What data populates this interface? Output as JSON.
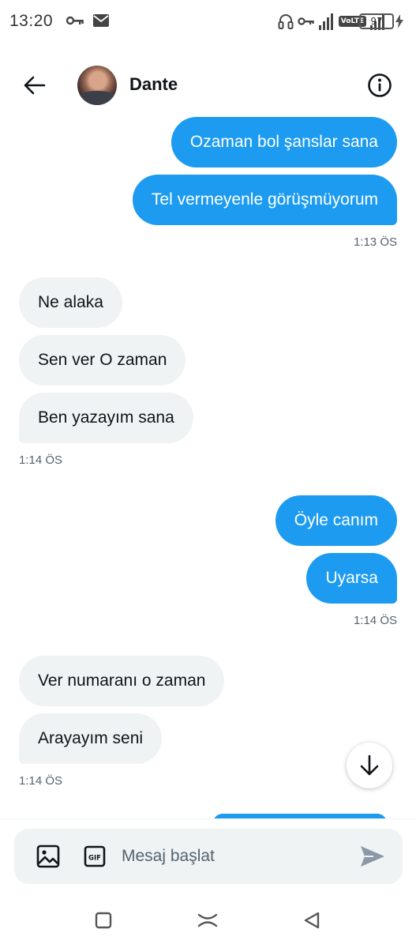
{
  "status_bar": {
    "time": "13:20",
    "network_badge": "VoLTE",
    "battery": "97",
    "icons": [
      "key-icon",
      "mail-icon",
      "headset-icon",
      "vpn-key-icon",
      "signal-icon",
      "charging-bolt-icon"
    ]
  },
  "header": {
    "contact_name": "Dante",
    "icons": [
      "back-arrow-icon",
      "avatar",
      "info-icon"
    ]
  },
  "messages": [
    {
      "direction": "out",
      "text": "Ozaman bol şanslar sana"
    },
    {
      "direction": "out",
      "text": "Tel vermeyenle görüşmüyorum",
      "time": "1:13 ÖS"
    },
    {
      "direction": "in",
      "text": "Ne alaka"
    },
    {
      "direction": "in",
      "text": "Sen ver O zaman"
    },
    {
      "direction": "in",
      "text": "Ben yazayım sana",
      "time": "1:14 ÖS"
    },
    {
      "direction": "out",
      "text": "Öyle canım"
    },
    {
      "direction": "out",
      "text": "Uyarsa",
      "time": "1:14 ÖS"
    },
    {
      "direction": "in",
      "text": "Ver numaranı o zaman"
    },
    {
      "direction": "in",
      "text": "Arayayım seni",
      "time": "1:14 ÖS"
    }
  ],
  "composer": {
    "placeholder": "Mesaj başlat",
    "value": "",
    "gif_label": "GIF",
    "icons": [
      "image-icon",
      "gif-icon",
      "send-icon"
    ]
  },
  "scroll_button_icon": "arrow-down-icon",
  "nav_bar": {
    "icons": [
      "recents-square-icon",
      "home-icon",
      "back-triangle-icon"
    ]
  },
  "colors": {
    "outgoing_bubble": "#1d9bf0",
    "incoming_bubble": "#eff3f4",
    "text_primary": "#0f1419",
    "text_secondary": "#536471"
  }
}
